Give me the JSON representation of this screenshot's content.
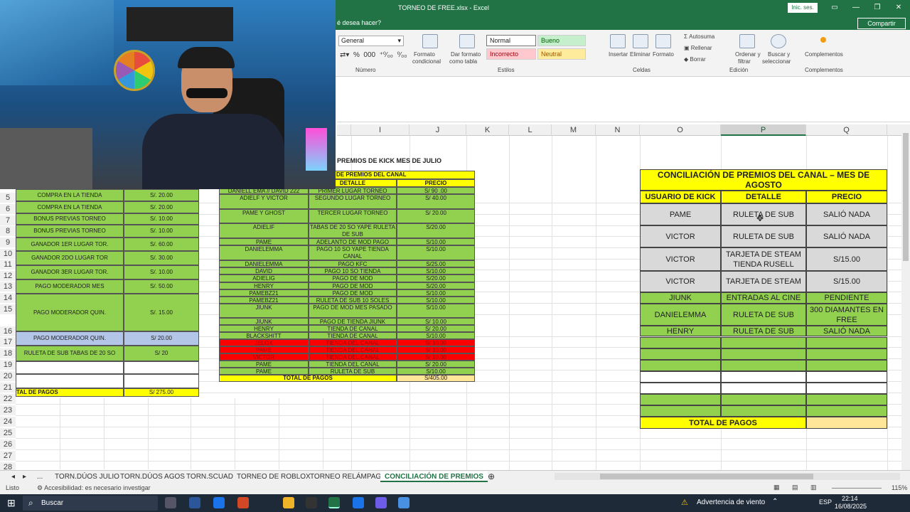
{
  "window": {
    "title": "TORNEO DE FREE.xlsx - Excel",
    "signin": "Inic. ses.",
    "share": "Compartir",
    "tell_me": "é desea hacer?"
  },
  "ribbon": {
    "number_format": "General",
    "numero_group": "Número",
    "conditional_format": [
      "Formato",
      "condicional"
    ],
    "format_table": [
      "Dar formato",
      "como tabla"
    ],
    "styles": {
      "normal": "Normal",
      "bueno": "Bueno",
      "incorrecto": "Incorrecto",
      "neutral": "Neutral"
    },
    "estilos_group": "Estilos",
    "insertar": "Insertar",
    "eliminar": "Eliminar",
    "formato": "Formato",
    "celdas_group": "Celdas",
    "autosuma": "Autosuma",
    "rellenar": "Rellenar",
    "borrar": "Borrar",
    "ordenar": [
      "Ordenar y",
      "filtrar"
    ],
    "buscar": [
      "Buscar y",
      "seleccionar"
    ],
    "edicion_group": "Edición",
    "complementos": "Complementos",
    "complementos_group": "Complementos"
  },
  "columns": [
    "I",
    "J",
    "K",
    "L",
    "M",
    "N",
    "O",
    "P",
    "Q"
  ],
  "rows": [
    "5",
    "6",
    "7",
    "8",
    "9",
    "10",
    "11",
    "12",
    "13",
    "14",
    "15",
    "16",
    "17",
    "18",
    "19",
    "20",
    "21",
    "22",
    "23",
    "24",
    "25",
    "26",
    "27",
    "28"
  ],
  "left_table": {
    "rows": [
      {
        "detalle": "COMPRA EN LA TIENDA",
        "precio": "S/. 20.00"
      },
      {
        "detalle": "COMPRA EN LA TIENDA",
        "precio": "S/. 20.00"
      },
      {
        "detalle": "BONUS PREVIAS TORNEO",
        "precio": "S/. 10.00"
      },
      {
        "detalle": "BONUS PREVIAS TORNEO",
        "precio": "S/. 10.00"
      },
      {
        "detalle": "GANADOR 1ER LUGAR TOR.",
        "precio": "S/. 60.00"
      },
      {
        "detalle": "GANADOR 2DO LUGAR TOR",
        "precio": "S/. 30.00"
      },
      {
        "detalle": "GANADOR 3ER LUGAR TOR.",
        "precio": "S/. 10.00"
      },
      {
        "detalle": "PAGO MODERADOR MES",
        "precio": "S/. 50.00"
      },
      {
        "detalle": "PAGO MODERADOR QUIN.",
        "precio": "S/. 15.00"
      },
      {
        "detalle": "PAGO MODERADOR QUIN.",
        "precio": "S/ 20.00"
      },
      {
        "detalle": "RULETA DE SUB TABAS DE 20 SO",
        "precio": "S/ 20"
      }
    ],
    "total_label": "TAL DE PAGOS",
    "total": "S/ 275.00"
  },
  "mid_table": {
    "title": "PREMIOS DE KICK MES DE JULIO",
    "subtitle": "DE PREMIOS DEL CANAL",
    "headers": [
      "DETALLE",
      "PRECIO"
    ],
    "rows": [
      {
        "user": "DANIELL EMA // DAVID 222",
        "detalle": "PRIMER LUGAR TORNEO",
        "precio": "S/ 90 .00",
        "c": "g"
      },
      {
        "user": "ADIELF Y VICTOR",
        "detalle": "SEGUNDO LUGAR TORNEO",
        "precio": "S/ 40.00",
        "c": "g"
      },
      {
        "user": "PAME Y GHOST",
        "detalle": "TERCER LUGAR TORNEO",
        "precio": "S/ 20.00",
        "c": "g"
      },
      {
        "user": "ADIELIF",
        "detalle": "TABAS DE 20 SO YAPE RULETA DE SUB",
        "precio": "S/20.00",
        "c": "g"
      },
      {
        "user": "PAME",
        "detalle": "ADELANTO DE MOD PAGO",
        "precio": "S/10.00",
        "c": "g"
      },
      {
        "user": "DANIELEMMA",
        "detalle": "PAGO 10 SO YAPE TIENDA CANAL",
        "precio": "S/10.00",
        "c": "g"
      },
      {
        "user": "DANIELEMMA",
        "detalle": "PAGO KFC",
        "precio": "S/25.00",
        "c": "g"
      },
      {
        "user": "DAVID",
        "detalle": "PAGO 10 SO TIENDA",
        "precio": "S/10.00",
        "c": "g"
      },
      {
        "user": "ADIELIG",
        "detalle": "PAGO DE MOD",
        "precio": "S/20.00",
        "c": "g"
      },
      {
        "user": "HENRY",
        "detalle": "PAGO DE MOD",
        "precio": "S/20.00",
        "c": "g"
      },
      {
        "user": "PAMEBZ21",
        "detalle": "PAGO DE MOD",
        "precio": "S/10.00",
        "c": "g"
      },
      {
        "user": "PAMEBZ21",
        "detalle": "RULETA DE SUB 10 SOLES",
        "precio": "S/10.00",
        "c": "g"
      },
      {
        "user": "JIUNK",
        "detalle": "PAGO DE MOD MES PASADO",
        "precio": "S/10.00",
        "c": "g"
      },
      {
        "user": "JIUNK",
        "detalle": "PAGO DE TIENDA JIUNK",
        "precio": "S/ 10.00",
        "c": "g"
      },
      {
        "user": "HENRY",
        "detalle": "TIENDA DE CANAL",
        "precio": "S/ 20.00",
        "c": "g"
      },
      {
        "user": "BLACKSHITT",
        "detalle": "TIENDA DE CANAL",
        "precio": "S/10.00",
        "c": "g"
      },
      {
        "user": "JELOX",
        "detalle": "TIENDA DEL CANAL",
        "precio": "S/ 10.00",
        "c": "r"
      },
      {
        "user": "PAME",
        "detalle": "TIENDA DEL CANAL",
        "precio": "S/ 10.00",
        "c": "r"
      },
      {
        "user": "VICTOR",
        "detalle": "TIENDA DEL CANAL",
        "precio": "S/ 10.00",
        "c": "r"
      },
      {
        "user": "PAME",
        "detalle": "TIENDA DEL CANAL",
        "precio": "S/ 20.00",
        "c": "g"
      },
      {
        "user": "PAME",
        "detalle": "RULETA DE SUB",
        "precio": "S/10.00",
        "c": "g"
      }
    ],
    "total_label": "TOTAL DE PAGOS",
    "total": "S/405.00"
  },
  "right_table": {
    "title": "CONCILIACIÓN DE PREMIOS DEL CANAL – MES DE AGOSTO",
    "headers": [
      "USUARIO DE KICK",
      "DETALLE",
      "PRECIO"
    ],
    "rows": [
      {
        "user": "PAME",
        "detalle": "RULETA DE SUB",
        "precio": "SALIÓ NADA",
        "c": "gr"
      },
      {
        "user": "VICTOR",
        "detalle": "RULETA DE SUB",
        "precio": "SALIÓ NADA",
        "c": "gr"
      },
      {
        "user": "VICTOR",
        "detalle": "TARJETA DE STEAM TIENDA RUSELL",
        "precio": "S/15.00",
        "c": "gr"
      },
      {
        "user": "VICTOR",
        "detalle": "TARJETA DE STEAM",
        "precio": "S/15.00",
        "c": "gr"
      },
      {
        "user": "JIUNK",
        "detalle": "ENTRADAS AL CINE",
        "precio": "PENDIENTE",
        "c": "g"
      },
      {
        "user": "DANIELEMMA",
        "detalle": "RULETA DE SUB",
        "precio": "300 DIAMANTES EN FREE",
        "c": "g"
      },
      {
        "user": "HENRY",
        "detalle": "RULETA DE SUB",
        "precio": "SALIÓ NADA",
        "c": "g"
      }
    ],
    "total_label": "TOTAL DE PAGOS"
  },
  "tabs": [
    "...",
    "TORN.DÚOS JULIO",
    "TORN.DÚOS AGOS",
    "TORN.SCUAD",
    "TORNEO DE ROBLOX",
    "TORNEO RELÁMPAGO",
    "CONCILIACIÓN DE PREMIOS"
  ],
  "status": {
    "ready": "Listo",
    "accessibility": "Accesibilidad: es necesario investigar",
    "zoom": "115%"
  },
  "taskbar": {
    "search": "Buscar",
    "weather": "Advertencia de viento",
    "lang": "ESP",
    "time": "22:14",
    "date": "16/08/2025"
  },
  "colors": {
    "excel_green": "#217346",
    "cell_green": "#92d050",
    "cell_yellow": "#ffff00",
    "cell_red": "#ff0000",
    "cell_gray": "#d9d9d9"
  }
}
